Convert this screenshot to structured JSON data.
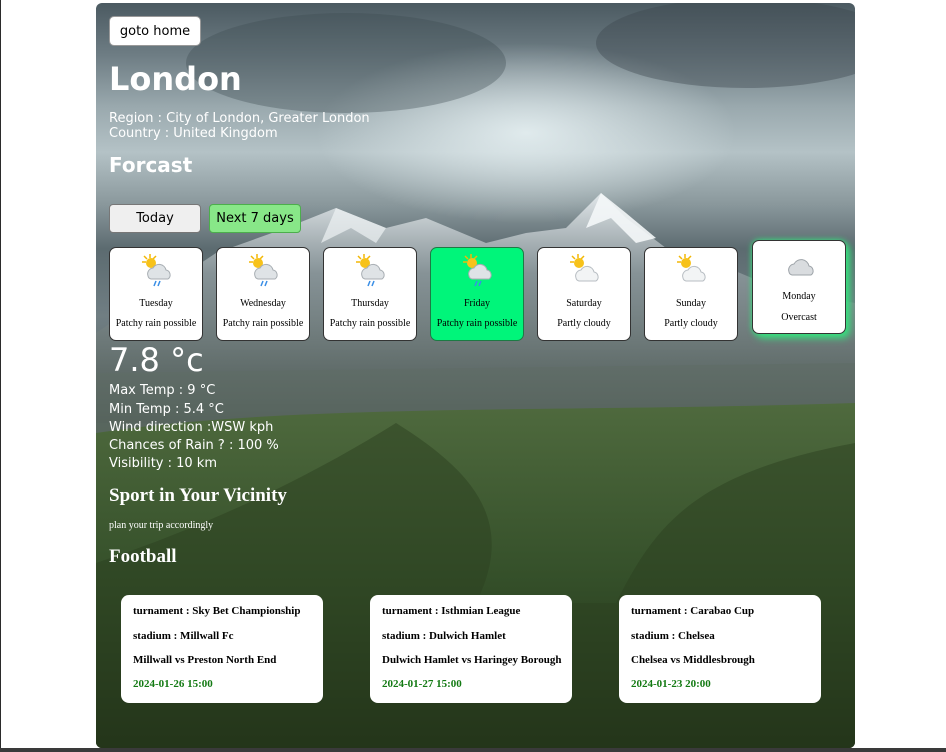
{
  "nav": {
    "home_label": "goto home"
  },
  "location": {
    "city": "London",
    "region_line": "Region : City of London, Greater London",
    "country_line": "Country : United Kingdom"
  },
  "forecast": {
    "title": "Forcast",
    "tabs": {
      "today": "Today",
      "next": "Next 7 days"
    },
    "days": [
      {
        "name": "Tuesday",
        "condition": "Patchy rain possible",
        "icon": "patchy-rain-icon"
      },
      {
        "name": "Wednesday",
        "condition": "Patchy rain possible",
        "icon": "patchy-rain-icon"
      },
      {
        "name": "Thursday",
        "condition": "Patchy rain possible",
        "icon": "patchy-rain-icon"
      },
      {
        "name": "Friday",
        "condition": "Patchy rain possible",
        "icon": "patchy-rain-icon"
      },
      {
        "name": "Saturday",
        "condition": "Partly cloudy",
        "icon": "partly-cloudy-icon"
      },
      {
        "name": "Sunday",
        "condition": "Partly cloudy",
        "icon": "partly-cloudy-icon"
      },
      {
        "name": "Monday",
        "condition": "Overcast",
        "icon": "overcast-icon"
      }
    ],
    "selected_day": "Friday",
    "highlight_color": "#00f57a"
  },
  "details": {
    "temperature": "7.8 °c",
    "max_temp": "Max Temp : 9 °C",
    "min_temp": "Min Temp : 5.4 °C",
    "wind": "Wind direction :WSW kph",
    "rain": "Chances of Rain ? : 100 %",
    "visibility": "Visibility : 10 km"
  },
  "sport": {
    "title": "Sport in Your Vicinity",
    "subtitle": "plan your trip accordingly",
    "category": "Football",
    "matches": [
      {
        "tournament": "turnament : Sky Bet Championship",
        "stadium": "stadium : Millwall Fc",
        "teams": "Millwall vs Preston North End",
        "date": "2024-01-26 15:00"
      },
      {
        "tournament": "turnament : Isthmian League",
        "stadium": "stadium : Dulwich Hamlet",
        "teams": "Dulwich Hamlet vs Haringey Borough",
        "date": "2024-01-27 15:00"
      },
      {
        "tournament": "turnament : Carabao Cup",
        "stadium": "stadium : Chelsea",
        "teams": "Chelsea vs Middlesbrough",
        "date": "2024-01-23 20:00"
      }
    ]
  }
}
